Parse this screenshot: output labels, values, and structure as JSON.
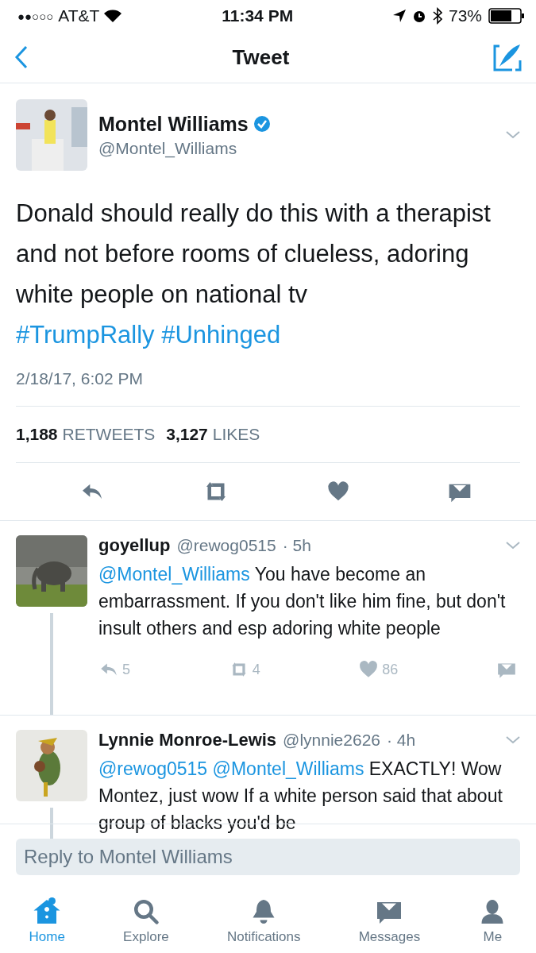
{
  "status_bar": {
    "signal_bars": "●●○○○",
    "carrier": "AT&T",
    "time": "11:34 PM",
    "battery": "73%"
  },
  "nav": {
    "title": "Tweet"
  },
  "tweet": {
    "name": "Montel Williams",
    "verified": true,
    "handle": "@Montel_Williams",
    "text": [
      {
        "kind": "plain",
        "text": "Donald should really do this with a therapist and not before rooms of clueless, adoring white people on national tv "
      },
      {
        "kind": "link",
        "text": "#TrumpRally"
      },
      {
        "kind": "link",
        "text": "#Unhinged"
      }
    ],
    "timestamp": "2/18/17, 6:02 PM",
    "stats": [
      {
        "count": "1,188",
        "label": "RETWEETS"
      },
      {
        "count": "3,127",
        "label": "LIKES"
      }
    ]
  },
  "replies": [
    {
      "name": "goyellup",
      "handle": "@rewog0515",
      "age": "· 5h",
      "thread_below": true,
      "text": [
        {
          "kind": "link",
          "text": "@Montel_Williams"
        },
        {
          "kind": "plain",
          "text": " You have become an embarrassment. If you don't like him fine, but don't insult others and esp adoring white people"
        }
      ],
      "actions": [
        "5",
        "4",
        "86"
      ]
    },
    {
      "name": "Lynnie Monroe-Lewis",
      "handle": "@lynnie2626",
      "age": "· 4h",
      "thread_below": true,
      "text": [
        {
          "kind": "link",
          "text": "@rewog0515"
        },
        {
          "kind": "link",
          "text": "@Montel_Williams"
        },
        {
          "kind": "plain",
          "text": " EXACTLY! Wow Montez, just wow If a white person said that about group of blacks you'd be"
        }
      ]
    }
  ],
  "composer": {
    "placeholder": "Reply to Montel Williams"
  },
  "tabs": [
    {
      "label": "Home",
      "selected": true,
      "badge": true
    },
    {
      "label": "Explore",
      "selected": false,
      "badge": false
    },
    {
      "label": "Notifications",
      "selected": false,
      "badge": false
    },
    {
      "label": "Messages",
      "selected": false,
      "badge": false
    },
    {
      "label": "Me",
      "selected": false,
      "badge": false
    }
  ]
}
